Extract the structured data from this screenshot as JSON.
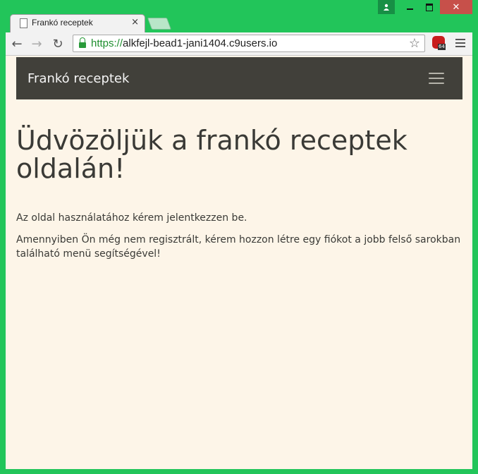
{
  "browser": {
    "tab": {
      "title": "Frankó receptek",
      "close_glyph": "×"
    },
    "toolbar": {
      "back_glyph": "←",
      "forward_glyph": "→",
      "reload_glyph": "↻",
      "url_scheme": "https://",
      "url_rest": "alkfejl-bead1-jani1404.c9users.io",
      "star_glyph": "☆",
      "extension_badge": "64"
    },
    "window_controls": {
      "user_glyph": "👤",
      "close_glyph": "✕"
    }
  },
  "page": {
    "navbar": {
      "brand": "Frankó receptek"
    },
    "heading": "Üdvözöljük a frankó receptek oldalán!",
    "paragraph1": "Az oldal használatához kérem jelentkezzen be.",
    "paragraph2": "Amennyiben Ön még nem regisztrált, kérem hozzon létre egy fiókot a jobb felső sarokban található menü segítségével!"
  },
  "colors": {
    "window_frame": "#22c55a",
    "navbar_bg": "#41403a",
    "page_bg": "#fdf5e8",
    "url_scheme": "#1f8f2f"
  }
}
